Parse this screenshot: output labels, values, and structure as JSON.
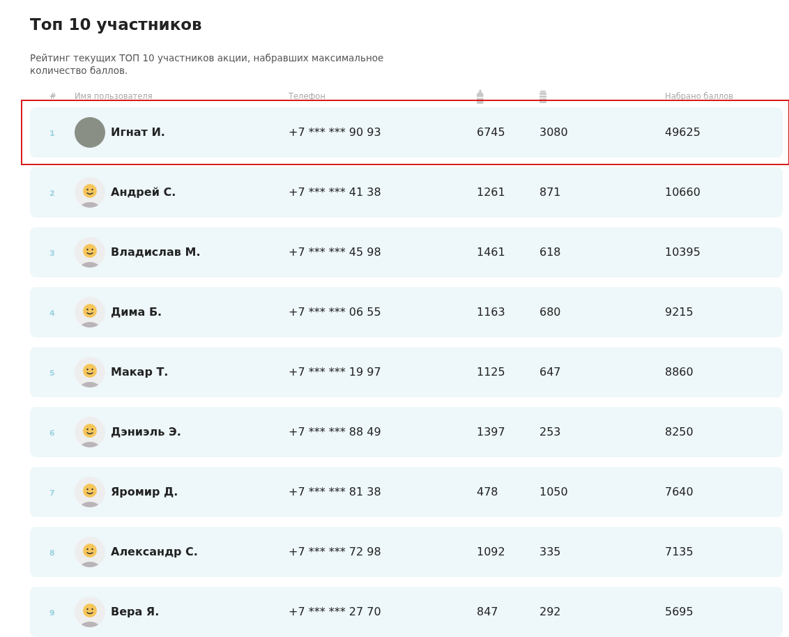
{
  "title": "Топ 10 участников",
  "description": "Рейтинг текущих ТОП 10 участников акции, набравших максимальное количество баллов.",
  "table": {
    "columns": [
      {
        "kind": "text",
        "label": "#"
      },
      {
        "kind": "text",
        "label": "Имя пользователя"
      },
      {
        "kind": "text",
        "label": "Телефон"
      },
      {
        "kind": "bottle-icon"
      },
      {
        "kind": "can-icon"
      },
      {
        "kind": "text",
        "label": "Набрано баллов"
      }
    ],
    "rows": [
      {
        "rank": "1",
        "kind": "photo",
        "name": "Игнат И.",
        "phone": "+7 *** *** 90 93",
        "column_4": "6745",
        "column_5": "3080",
        "points": "49625",
        "highlighted": true
      },
      {
        "rank": "2",
        "kind": "default",
        "name": "Андрей С.",
        "phone": "+7 *** *** 41 38",
        "column_4": "1261",
        "column_5": "871",
        "points": "10660",
        "highlighted": false
      },
      {
        "rank": "3",
        "kind": "default",
        "name": "Владислав М.",
        "phone": "+7 *** *** 45 98",
        "column_4": "1461",
        "column_5": "618",
        "points": "10395",
        "highlighted": false
      },
      {
        "rank": "4",
        "kind": "default",
        "name": "Дима Б.",
        "phone": "+7 *** *** 06 55",
        "column_4": "1163",
        "column_5": "680",
        "points": "9215",
        "highlighted": false
      },
      {
        "rank": "5",
        "kind": "default",
        "name": "Макар Т.",
        "phone": "+7 *** *** 19 97",
        "column_4": "1125",
        "column_5": "647",
        "points": "8860",
        "highlighted": false
      },
      {
        "rank": "6",
        "kind": "default",
        "name": "Дэниэль Э.",
        "phone": "+7 *** *** 88 49",
        "column_4": "1397",
        "column_5": "253",
        "points": "8250",
        "highlighted": false
      },
      {
        "rank": "7",
        "kind": "default",
        "name": "Яромир Д.",
        "phone": "+7 *** *** 81 38",
        "column_4": "478",
        "column_5": "1050",
        "points": "7640",
        "highlighted": false
      },
      {
        "rank": "8",
        "kind": "default",
        "name": "Александр С.",
        "phone": "+7 *** *** 72 98",
        "column_4": "1092",
        "column_5": "335",
        "points": "7135",
        "highlighted": false
      },
      {
        "rank": "9",
        "kind": "default",
        "name": "Вера Я.",
        "phone": "+7 *** *** 27 70",
        "column_4": "847",
        "column_5": "292",
        "points": "5695",
        "highlighted": false
      }
    ]
  }
}
